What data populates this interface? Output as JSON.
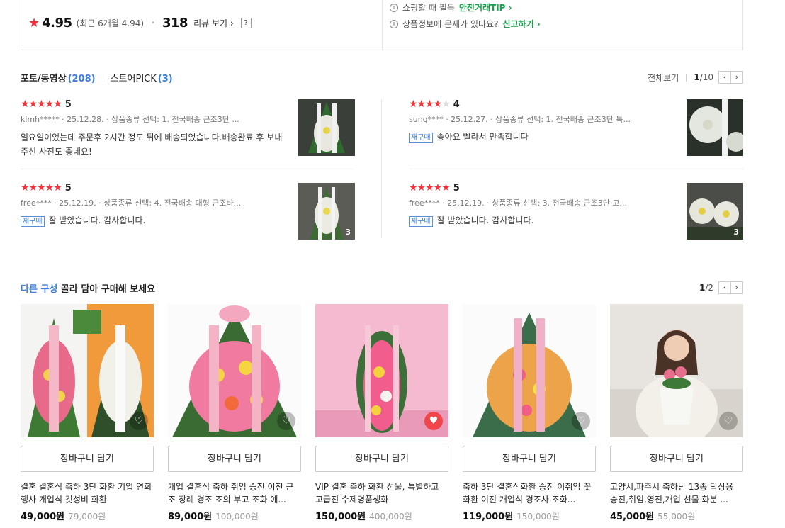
{
  "summary": {
    "rating": "4.95",
    "recent": "(최근 6개월 4.94)",
    "review_count": "318",
    "review_link": "리뷰 보기 ›",
    "help": "?",
    "tip1_text": "쇼핑할 때 필독",
    "tip1_link": "안전거래TIP ›",
    "tip2_text": "상품정보에 문제가 있나요?",
    "tip2_link": "신고하기 ›"
  },
  "reviews_header": {
    "tab1": "포토/동영상",
    "tab1_count": "(208)",
    "tab2": "스토어PICK",
    "tab2_count": "(3)",
    "view_all": "전체보기",
    "page_current": "1",
    "page_total": "/10"
  },
  "reviews": [
    {
      "score": "5",
      "stars": 5,
      "meta": "kimh***** · 25.12.28. · 상품종류 선택: 1. 전국배송 근조3단 ...",
      "rebuy": "",
      "text": "일요일이었는데 주문후 2시간 정도 뒤에 배송되었습니다.배송완료 후 보내주신 사진도 좋네요!",
      "photo_count": ""
    },
    {
      "score": "4",
      "stars": 4,
      "meta": "sung**** · 25.12.27. · 상품종류 선택: 1. 전국배송 근조3단 특...",
      "rebuy": "재구매",
      "text": "좋아요 빨라서 만족합니다",
      "photo_count": ""
    },
    {
      "score": "5",
      "stars": 5,
      "meta": "free**** · 25.12.19. · 상품종류 선택: 4. 전국배송 대형 근조바...",
      "rebuy": "재구매",
      "text": "잘 받았습니다. 감사합니다.",
      "photo_count": "3"
    },
    {
      "score": "5",
      "stars": 5,
      "meta": "free**** · 25.12.19. · 상품종류 선택: 3. 전국배송 근조3단 고...",
      "rebuy": "재구매",
      "text": "잘 받았습니다. 감사합니다.",
      "photo_count": "3"
    }
  ],
  "products_header": {
    "title_blue": "다른 구성",
    "title_rest": " 골라 담아 구매해 보세요",
    "page_current": "1",
    "page_total": "/2"
  },
  "products": [
    {
      "cart": "장바구니 담기",
      "name": "결혼 결혼식 축하 3단 화환 기업 연회 행사 개업식 갓성비 화환",
      "price": "49,000원",
      "orig": "79,000원"
    },
    {
      "cart": "장바구니 담기",
      "name": "개업 결혼식 축하 취임 승진 이전 근조 장례 경조 조의 부고 조화 예...",
      "price": "89,000원",
      "orig": "100,000원"
    },
    {
      "cart": "장바구니 담기",
      "name": "VIP 결혼 축하 화환 선물, 특별하고 고급진 수제명품생화",
      "price": "150,000원",
      "orig": "400,000원"
    },
    {
      "cart": "장바구니 담기",
      "name": "축하 3단 결혼식화환 승진 이취임 꽃 화환 이전 개업식 경조사 조화...",
      "price": "119,000원",
      "orig": "150,000원"
    },
    {
      "cart": "장바구니 담기",
      "name": "고양시,파주시 축하난 13종 탁상용 승진,취임,영전,개업 선물 화분 ...",
      "price": "45,000원",
      "orig": "55,000원"
    }
  ],
  "colors": {
    "accent_red": "#f5323c",
    "link_green": "#16a34a",
    "blue": "#3b7dd8"
  }
}
